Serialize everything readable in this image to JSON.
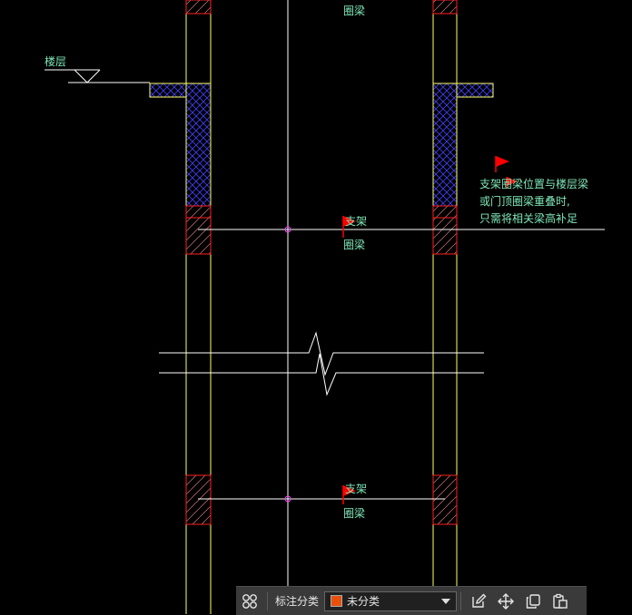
{
  "labels": {
    "floor": "楼层",
    "ringbeam_top": "圈梁",
    "support_1": "支架",
    "ringbeam_1": "圈梁",
    "support_2": "支架",
    "ringbeam_2": "圈梁",
    "note_line1": "支架圈梁位置与楼层梁",
    "note_line2": "或门顶圈梁重叠时,",
    "note_line3": "只需将相关梁高补足"
  },
  "toolbar": {
    "category_label": "标注分类",
    "category_value": "未分类",
    "category_color": "#e8500c"
  },
  "colors": {
    "background": "#000000",
    "wall_line": "#ffff66",
    "hatch": "#4040ff",
    "beam_outline": "#ff2020",
    "text": "#7fe7b8",
    "flag": "#ff0000",
    "center_line": "#ffffff",
    "node": "#ff40ff"
  }
}
